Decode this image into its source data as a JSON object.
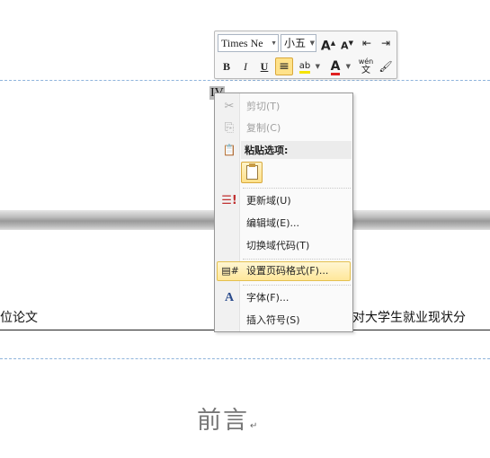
{
  "document": {
    "page_number": "IV",
    "footer_left": "位论文",
    "footer_right": "对大学生就业现状分",
    "heading": "前言",
    "paragraph_mark": "↵"
  },
  "mini_toolbar": {
    "font_name": "Times Ne",
    "font_size": "小五",
    "buttons": {
      "grow_font": "A",
      "shrink_font": "A",
      "decrease_indent": "⇤",
      "increase_indent": "⇥",
      "bold": "B",
      "italic": "I",
      "underline": "U",
      "center": "≡",
      "highlight": "ab",
      "font_color": "A",
      "phonetic": "wén",
      "format_painter": "🖌"
    }
  },
  "context_menu": {
    "items": [
      {
        "label": "剪切(T)",
        "icon": "scissors-icon",
        "glyph": "✂",
        "disabled": true
      },
      {
        "label": "复制(C)",
        "icon": "copy-icon",
        "glyph": "⎘",
        "disabled": true
      },
      {
        "label": "粘贴选项:",
        "icon": "paste-icon",
        "glyph": "📋",
        "header": true
      },
      {
        "label": "更新域(U)",
        "icon": "update-field-icon",
        "glyph": "!"
      },
      {
        "label": "编辑域(E)...",
        "icon": "",
        "glyph": ""
      },
      {
        "label": "切换域代码(T)",
        "icon": "",
        "glyph": ""
      },
      {
        "label": "设置页码格式(F)...",
        "icon": "page-number-format-icon",
        "glyph": "#",
        "highlighted": true
      },
      {
        "label": "字体(F)...",
        "icon": "font-icon",
        "glyph": "A"
      },
      {
        "label": "插入符号(S)",
        "icon": "",
        "glyph": ""
      }
    ]
  },
  "colors": {
    "highlight_yellow": "#ffe79a",
    "font_color_red": "#e02020",
    "header_dash": "#8fb4dc"
  }
}
